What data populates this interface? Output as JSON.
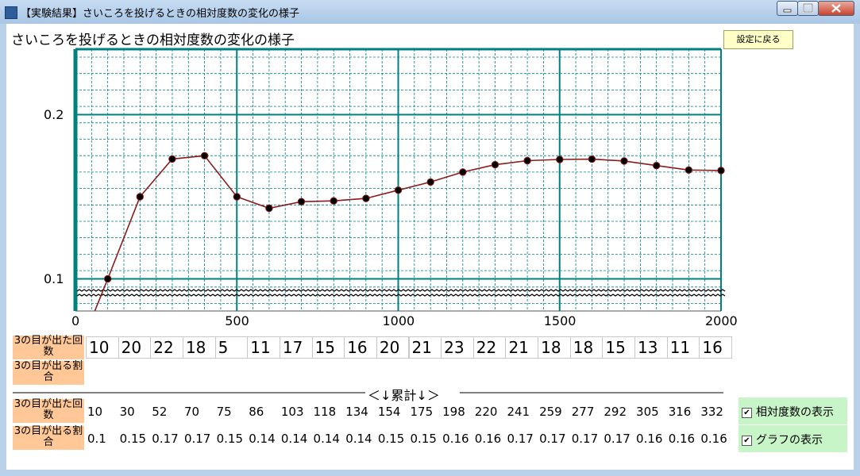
{
  "window": {
    "title": "【実験結果】さいころを投げるときの相対度数の変化の様子",
    "icon": "app-icon",
    "controls": [
      "minimize-icon",
      "maximize-icon",
      "close-icon"
    ]
  },
  "header": {
    "chart_title": "さいころを投げるときの相対度数の変化の様子",
    "back_button_label": "設定に戻る"
  },
  "chart_data": {
    "type": "line",
    "title": "さいころを投げるときの相対度数の変化の様子",
    "xlabel": "",
    "ylabel": "",
    "x_ticks": [
      "0",
      "500",
      "1000",
      "1500",
      "2000"
    ],
    "y_ticks": [
      "0.1",
      "0.2"
    ],
    "xlim": [
      0,
      2000
    ],
    "ylim": [
      0.08,
      0.23
    ],
    "y_axis_break": true,
    "grid": true,
    "line_color": "#8b1a1a",
    "marker_color": "#000000",
    "grid_color": "#008080",
    "x": [
      100,
      200,
      300,
      400,
      500,
      600,
      700,
      800,
      900,
      1000,
      1100,
      1200,
      1300,
      1400,
      1500,
      1600,
      1700,
      1800,
      1900,
      2000
    ],
    "y": [
      0.1,
      0.15,
      0.173,
      0.175,
      0.15,
      0.143,
      0.147,
      0.1475,
      0.149,
      0.154,
      0.159,
      0.165,
      0.1695,
      0.172,
      0.1727,
      0.1729,
      0.1718,
      0.169,
      0.1663,
      0.166
    ]
  },
  "counts": {
    "count_label": "3の目が出た回数",
    "ratio_label": "3の目が出る割合",
    "values": [
      "10",
      "20",
      "22",
      "18",
      "5",
      "11",
      "17",
      "15",
      "16",
      "20",
      "21",
      "23",
      "22",
      "21",
      "18",
      "18",
      "15",
      "13",
      "11",
      "16"
    ]
  },
  "cumulative": {
    "heading": "＜↓累計↓＞",
    "count_label": "3の目が出た回数",
    "ratio_label": "3の目が出る割合",
    "count_values": [
      "10",
      "30",
      "52",
      "70",
      "75",
      "86",
      "103",
      "118",
      "134",
      "154",
      "175",
      "198",
      "220",
      "241",
      "259",
      "277",
      "292",
      "305",
      "316",
      "332"
    ],
    "ratio_values": [
      "0.1",
      "0.15",
      "0.17",
      "0.17",
      "0.15",
      "0.14",
      "0.14",
      "0.14",
      "0.14",
      "0.15",
      "0.15",
      "0.16",
      "0.16",
      "0.17",
      "0.17",
      "0.17",
      "0.17",
      "0.16",
      "0.16",
      "0.16"
    ]
  },
  "options": {
    "show_relative_label": "相対度数の表示",
    "show_graph_label": "グラフの表示",
    "checkmark": "✔",
    "show_relative_checked": true,
    "show_graph_checked": true
  }
}
